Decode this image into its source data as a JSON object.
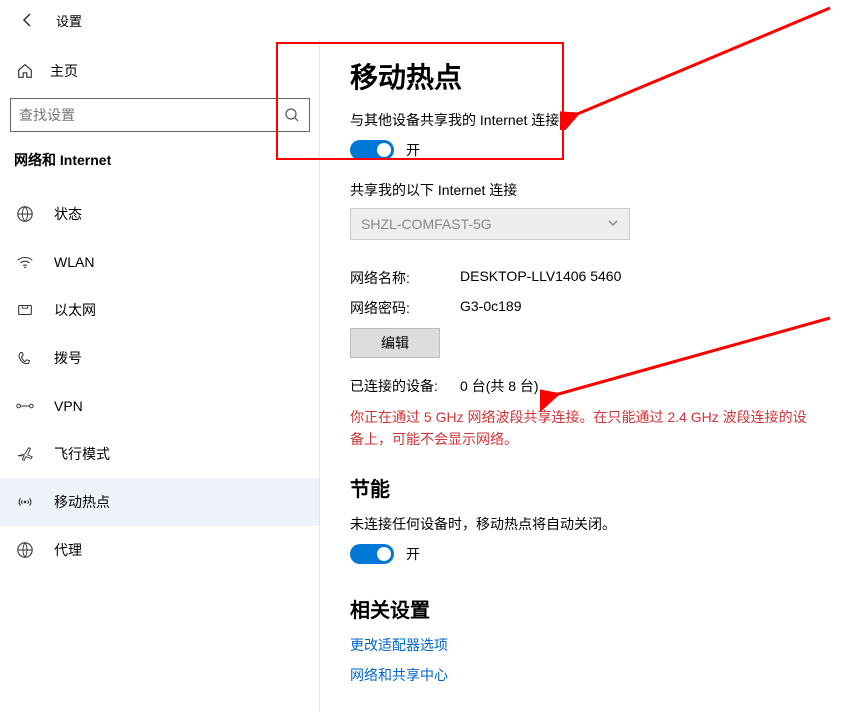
{
  "window": {
    "title": "设置"
  },
  "home": {
    "label": "主页"
  },
  "search": {
    "placeholder": "查找设置"
  },
  "section_header": "网络和 Internet",
  "nav": [
    {
      "label": "状态"
    },
    {
      "label": "WLAN"
    },
    {
      "label": "以太网"
    },
    {
      "label": "拨号"
    },
    {
      "label": "VPN"
    },
    {
      "label": "飞行模式"
    },
    {
      "label": "移动热点"
    },
    {
      "label": "代理"
    }
  ],
  "page": {
    "title": "移动热点",
    "share_desc": "与其他设备共享我的 Internet 连接",
    "toggle1_state": "开",
    "share_from_label": "共享我的以下 Internet 连接",
    "share_from_value": "SHZL-COMFAST-5G",
    "net_name_label": "网络名称:",
    "net_name_value": "DESKTOP-LLV1406 5460",
    "net_pwd_label": "网络密码:",
    "net_pwd_value": "G3-0c189",
    "edit_btn": "编辑",
    "connected_label": "已连接的设备:",
    "connected_value": "0 台(共 8 台)",
    "warning": "你正在通过 5 GHz 网络波段共享连接。在只能通过 2.4 GHz 波段连接的设备上，可能不会显示网络。",
    "power_title": "节能",
    "power_desc": "未连接任何设备时，移动热点将自动关闭。",
    "toggle2_state": "开",
    "related_title": "相关设置",
    "link1": "更改适配器选项",
    "link2": "网络和共享中心"
  }
}
